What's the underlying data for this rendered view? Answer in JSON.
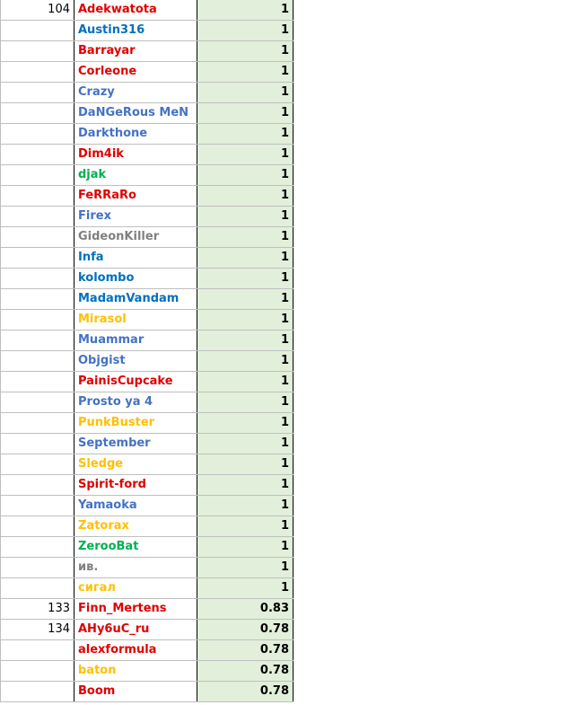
{
  "colors": {
    "red": "#e00000",
    "blue": "#0070c0",
    "steel": "#4472c4",
    "green": "#00b050",
    "gray": "#808080",
    "gold": "#ffc000",
    "score_bg": "#e2efda"
  },
  "rows": [
    {
      "rank": "104",
      "name": "Adekwatota",
      "color": "red",
      "score": "1"
    },
    {
      "rank": "",
      "name": "Austin316",
      "color": "blue",
      "score": "1"
    },
    {
      "rank": "",
      "name": "Barrayar",
      "color": "red",
      "score": "1"
    },
    {
      "rank": "",
      "name": "Corleone",
      "color": "red",
      "score": "1"
    },
    {
      "rank": "",
      "name": "Crazy",
      "color": "steel",
      "score": "1"
    },
    {
      "rank": "",
      "name": "DaNGeRous MeN",
      "color": "steel",
      "score": "1"
    },
    {
      "rank": "",
      "name": "Darkthone",
      "color": "steel",
      "score": "1"
    },
    {
      "rank": "",
      "name": "Dim4ik",
      "color": "red",
      "score": "1"
    },
    {
      "rank": "",
      "name": "djak",
      "color": "green",
      "score": "1"
    },
    {
      "rank": "",
      "name": "FeRRaRo",
      "color": "red",
      "score": "1"
    },
    {
      "rank": "",
      "name": "Firex",
      "color": "steel",
      "score": "1"
    },
    {
      "rank": "",
      "name": "GideonKiller",
      "color": "gray",
      "score": "1"
    },
    {
      "rank": "",
      "name": "Infa",
      "color": "blue",
      "score": "1"
    },
    {
      "rank": "",
      "name": "kolombo",
      "color": "blue",
      "score": "1"
    },
    {
      "rank": "",
      "name": "MadamVandam",
      "color": "blue",
      "score": "1"
    },
    {
      "rank": "",
      "name": "Mirasol",
      "color": "gold",
      "score": "1"
    },
    {
      "rank": "",
      "name": "Muammar",
      "color": "steel",
      "score": "1"
    },
    {
      "rank": "",
      "name": "Objgist",
      "color": "steel",
      "score": "1"
    },
    {
      "rank": "",
      "name": "PainisCupcake",
      "color": "red",
      "score": "1"
    },
    {
      "rank": "",
      "name": "Prosto ya 4",
      "color": "steel",
      "score": "1"
    },
    {
      "rank": "",
      "name": "PunkBuster",
      "color": "gold",
      "score": "1"
    },
    {
      "rank": "",
      "name": "September",
      "color": "steel",
      "score": "1"
    },
    {
      "rank": "",
      "name": "Sledge",
      "color": "gold",
      "score": "1"
    },
    {
      "rank": "",
      "name": "Spirit-ford",
      "color": "red",
      "score": "1"
    },
    {
      "rank": "",
      "name": "Yamaoka",
      "color": "steel",
      "score": "1"
    },
    {
      "rank": "",
      "name": "Zatorax",
      "color": "gold",
      "score": "1"
    },
    {
      "rank": "",
      "name": "ZerooBat",
      "color": "green",
      "score": "1"
    },
    {
      "rank": "",
      "name": "ив.",
      "color": "gray",
      "score": "1"
    },
    {
      "rank": "",
      "name": "сигал",
      "color": "gold",
      "score": "1"
    },
    {
      "rank": "133",
      "name": "Finn_Mertens",
      "color": "red",
      "score": "0.83"
    },
    {
      "rank": "134",
      "name": "AHy6uC_ru",
      "color": "red",
      "score": "0.78"
    },
    {
      "rank": "",
      "name": "alexformula",
      "color": "red",
      "score": "0.78"
    },
    {
      "rank": "",
      "name": "baton",
      "color": "gold",
      "score": "0.78"
    },
    {
      "rank": "",
      "name": "Boom",
      "color": "red",
      "score": "0.78"
    }
  ]
}
